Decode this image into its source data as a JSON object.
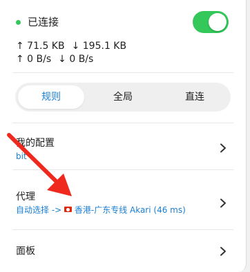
{
  "status": {
    "label": "已连接",
    "dot_color": "#34c759"
  },
  "toggle": {
    "on": true,
    "color": "#34c759"
  },
  "traffic": {
    "total_up": "↑ 71.5 KB",
    "total_down": "↓ 195.1 KB",
    "speed_up": "↑ 0 B/s",
    "speed_down": "↓ 0 B/s"
  },
  "mode": {
    "options": [
      "规则",
      "全局",
      "直连"
    ],
    "selected": "规则",
    "accent": "#1a7fd4"
  },
  "rows": {
    "config": {
      "title": "我的配置",
      "sub": "bit"
    },
    "proxy": {
      "title": "代理",
      "sub_prefix": "自动选择 ->",
      "sub_node": "香港-广东专线 Akari (46 ms)"
    },
    "panel": {
      "title": "面板"
    }
  },
  "annotation": {
    "arrow_color": "#f0291f",
    "icons": [
      "chevron-right-icon",
      "hong-kong-flag-icon",
      "red-arrow"
    ]
  }
}
